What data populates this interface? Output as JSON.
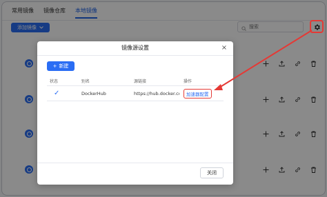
{
  "tabs": [
    {
      "label": "常用镜像"
    },
    {
      "label": "镜像仓库"
    },
    {
      "label": "本地镜像",
      "active": true
    }
  ],
  "toolbar": {
    "add_image_label": "添加镜像",
    "search_placeholder": "搜索"
  },
  "modal": {
    "title": "镜像源设置",
    "new_label": "新建",
    "columns": [
      "状态",
      "别名",
      "源链接",
      "操作"
    ],
    "rows": [
      {
        "status": "✓",
        "alias": "DockerHub",
        "url": "https://hub.docker.com/",
        "action": "加速器配置"
      }
    ],
    "close_label": "关闭"
  },
  "colors": {
    "accent": "#2a6df4",
    "annotation_red": "#e53935",
    "overlay": "rgba(0,0,0,0.46)"
  },
  "icons": {
    "gear": "gear-icon",
    "plus": "plus-icon",
    "upload": "upload-icon",
    "link": "link-icon",
    "trash": "trash-icon",
    "search": "search-icon",
    "chevron": "chevron-down-icon",
    "check": "check-icon",
    "close": "close-icon"
  }
}
